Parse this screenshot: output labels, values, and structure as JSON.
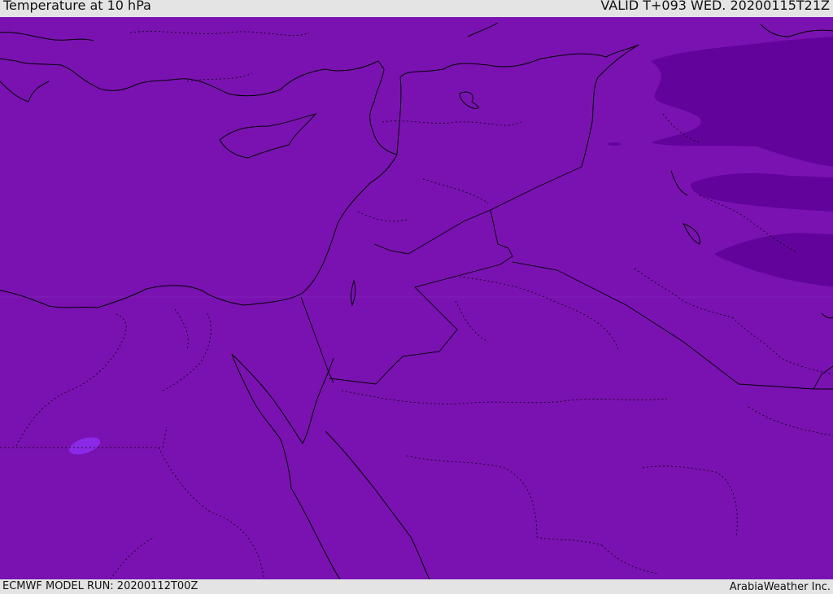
{
  "header": {
    "title": "Temperature at 10 hPa",
    "valid": "VALID T+093 WED. 20200115T21Z"
  },
  "footer": {
    "model_run": "ECMWF MODEL RUN: 20200112T00Z",
    "credit": "ArabiaWeather Inc."
  },
  "map": {
    "base_color": "#7a12b2",
    "cold_color": "#62049c",
    "warm_spot_color": "#8a2ae6",
    "coastline_color": "#000000"
  }
}
